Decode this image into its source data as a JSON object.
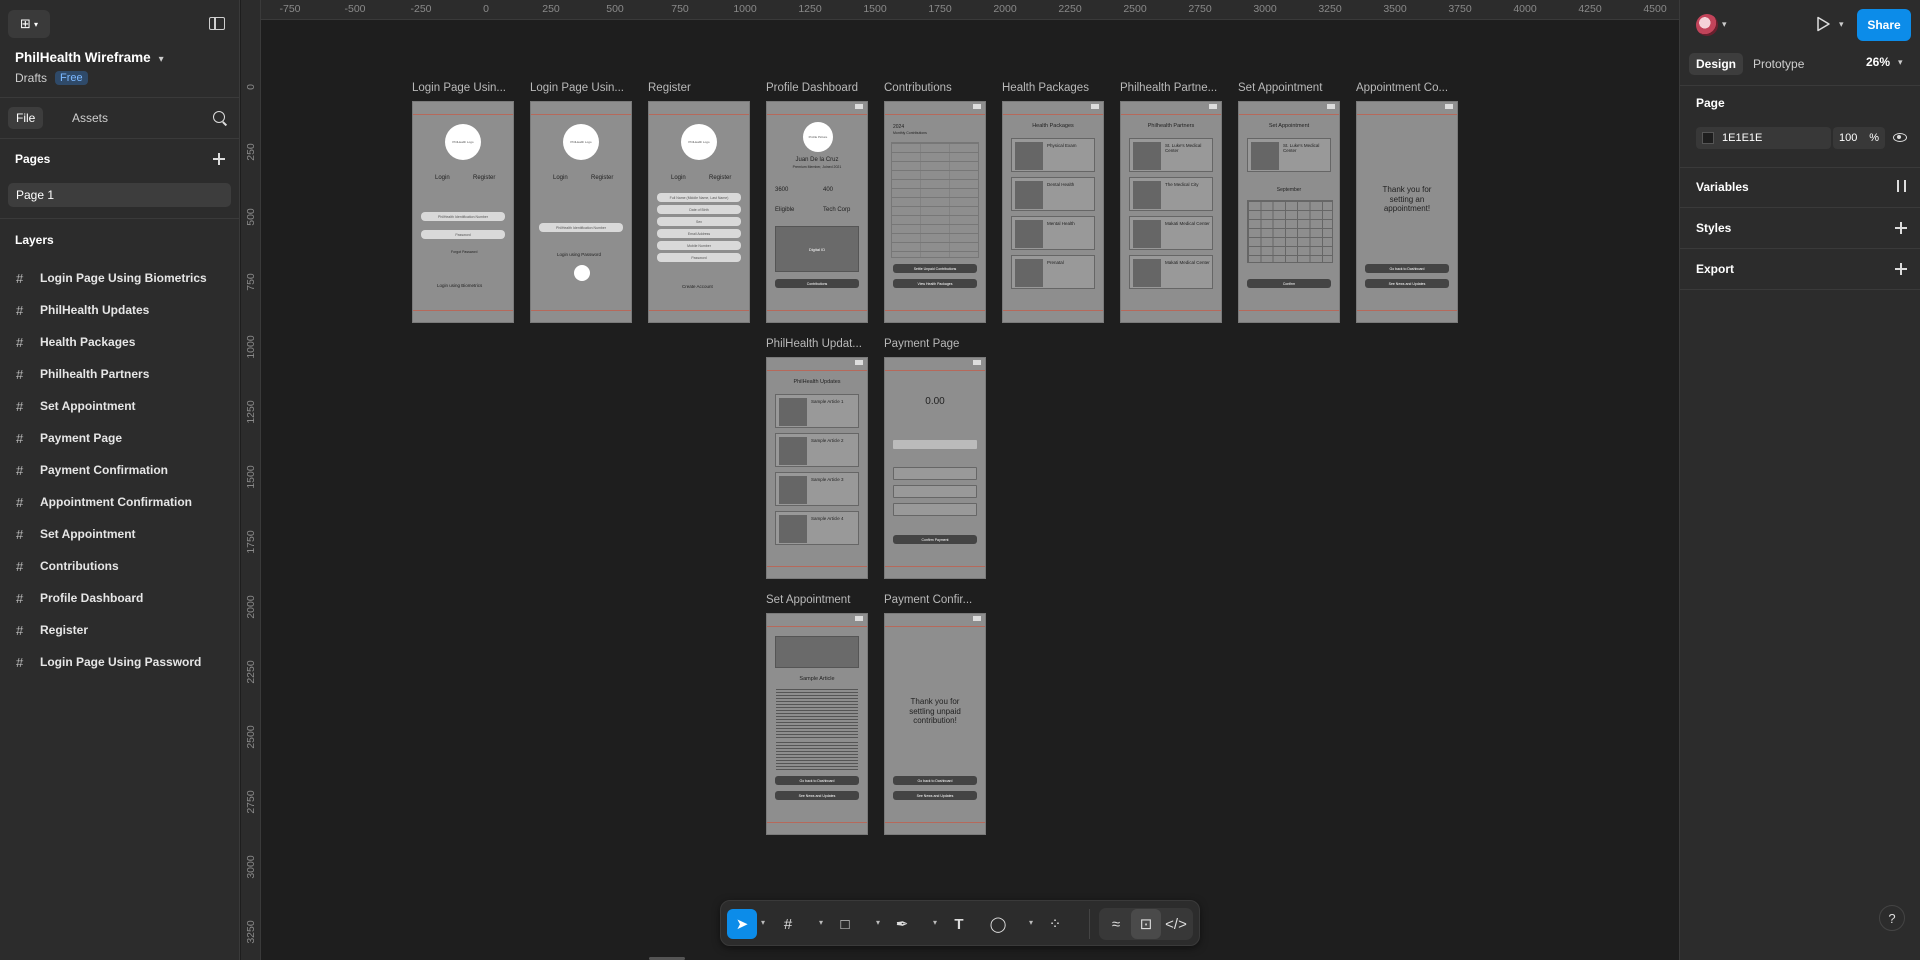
{
  "app": {
    "file_name": "PhilHealth Wireframe",
    "location": "Drafts",
    "plan_badge": "Free"
  },
  "left_tabs": {
    "file": "File",
    "assets": "Assets"
  },
  "pages": {
    "heading": "Pages",
    "items": [
      "Page 1"
    ]
  },
  "layers": {
    "heading": "Layers",
    "items": [
      "Login Page Using Biometrics",
      "PhilHealth Updates",
      "Health Packages",
      "Philhealth Partners",
      "Set Appointment",
      "Payment Page",
      "Payment Confirmation",
      "Appointment Confirmation",
      "Set Appointment",
      "Contributions",
      "Profile Dashboard",
      "Register",
      "Login Page Using Password"
    ]
  },
  "right_panel": {
    "share": "Share",
    "tabs": {
      "design": "Design",
      "prototype": "Prototype"
    },
    "zoom": "26%",
    "page_section": "Page",
    "bg_color": "1E1E1E",
    "opacity": "100",
    "opacity_unit": "%",
    "variables": "Variables",
    "styles": "Styles",
    "export": "Export"
  },
  "ruler": {
    "x": [
      "-750",
      "-500",
      "-250",
      "0",
      "250",
      "500",
      "750",
      "1000",
      "1250",
      "1500",
      "1750",
      "2000",
      "2250",
      "2500",
      "2750",
      "3000",
      "3250",
      "3500",
      "3750",
      "4000",
      "4250",
      "4500"
    ],
    "y": [
      "0",
      "250",
      "500",
      "750",
      "1000",
      "1250",
      "1500",
      "1750",
      "2000",
      "2250",
      "2500",
      "2750",
      "3000",
      "3250"
    ]
  },
  "frames": {
    "login_bio": {
      "label": "Login Page Usin...",
      "logo": "PhilHealth Logo",
      "login": "Login",
      "register": "Register",
      "field1": "PhilHealth Identification Number",
      "field2": "Password",
      "forgot": "Forgot Password",
      "bottom": "Login using Biometrics"
    },
    "login_pw": {
      "label": "Login Page Usin...",
      "logo": "PhilHealth Logo",
      "login": "Login",
      "register": "Register",
      "field1": "PhilHealth Identification Number",
      "bottom": "Login using Password"
    },
    "register": {
      "label": "Register",
      "logo": "PhilHealth Logo",
      "login": "Login",
      "register": "Register",
      "f1": "Full Name (Middle Name, Last Name)",
      "f2": "Date of Birth",
      "f3": "Sex",
      "f4": "Email Address",
      "f5": "Mobile Number",
      "f6": "Password",
      "bottom": "Create Account"
    },
    "profile": {
      "label": "Profile Dashboard",
      "logo": "Profile Picture",
      "name": "Juan De la Cruz",
      "sub": "Premium Member, Joined 2021",
      "stat1": "3600",
      "stat2": "400",
      "elig": "Eligible",
      "corp": "Tech Corp",
      "digital": "Digital ID",
      "btn": "Contributions"
    },
    "contributions": {
      "label": "Contributions",
      "year": "2024",
      "sub": "Monthly Contributions",
      "btn1": "Settle Unpaid Contributions",
      "btn2": "View Health Packages"
    },
    "health": {
      "label": "Health Packages",
      "title": "Health Packages",
      "c1": "Physical Exam",
      "c2": "Dental Health",
      "c3": "Mental Health",
      "c4": "Prenatal"
    },
    "partners": {
      "label": "Philhealth Partne...",
      "title": "Philhealth Partners",
      "c1": "St. Luke's Medical Center",
      "c2": "The Medical City",
      "c3": "Makati Medical Center",
      "c4": "Makati Medical Center"
    },
    "set_appt": {
      "label": "Set Appointment",
      "title": "Set Appointment",
      "hosp": "St. Luke's Medical Center",
      "month": "September",
      "btn": "Confirm"
    },
    "appt_conf": {
      "label": "Appointment Co...",
      "text": "Thank you for setting an appointment!",
      "btn1": "Go back to Dashboard",
      "btn2": "See News and Updates"
    },
    "updates": {
      "label": "PhilHealth Updat...",
      "title": "PhilHealth Updates",
      "a1": "Sample Article 1",
      "a2": "Sample Article 2",
      "a3": "Sample Article 3",
      "a4": "Sample Article 4"
    },
    "payment": {
      "label": "Payment Page",
      "amount": "0.00",
      "btn": "Confirm Payment"
    },
    "set_appt2": {
      "label": "Set Appointment",
      "title": "Sample Article",
      "btn1": "Go back to Dashboard",
      "btn2": "See News and Updates"
    },
    "pay_conf": {
      "label": "Payment Confir...",
      "text": "Thank you for settling unpaid contribution!",
      "btn1": "Go back to Dashboard",
      "btn2": "See News and Updates"
    }
  },
  "colors": {
    "accent": "#0c8ce9",
    "canvas": "#1e1e1e",
    "panel": "#2c2c2c",
    "frame": "#8e8e8e"
  }
}
